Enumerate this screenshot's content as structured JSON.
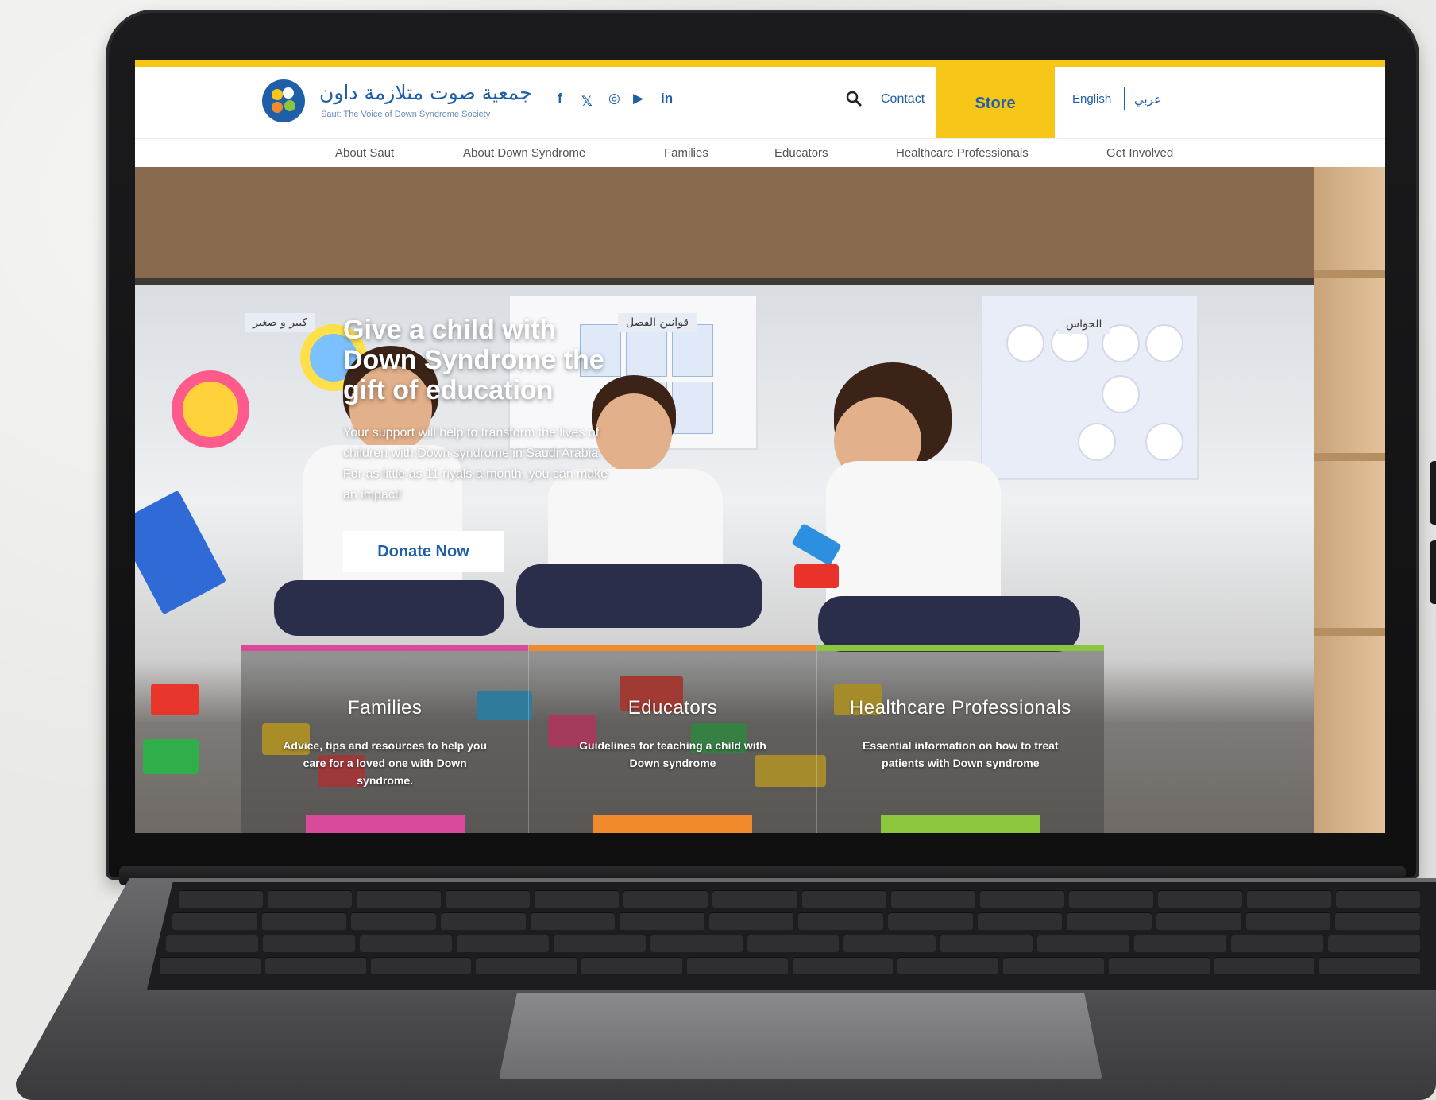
{
  "header": {
    "logo_title": "جمعية صوت متلازمة داون",
    "logo_subtitle": "Saut: The Voice of Down Syndrome Society",
    "social": [
      "f",
      "𝕏",
      "◎",
      "▶",
      "in"
    ],
    "search_placeholder": "",
    "contact_label": "Contact",
    "store_label": "Store",
    "lang_en": "English",
    "lang_ar": "عربي",
    "accent": "#f6c619",
    "brand": "#1f5fa8"
  },
  "nav": {
    "items": [
      "About Saut",
      "About Down Syndrome",
      "Families",
      "Educators",
      "Healthcare Professionals",
      "Get Involved"
    ]
  },
  "hero": {
    "title": "Give a child with Down Syndrome the gift of education",
    "text": "Your support will help to transform the lives of children with Down syndrome in Saudi Arabia. For as little as 11 riyals a month, you can make an impact!",
    "donate_label": "Donate Now",
    "tags": [
      "كبير و صغير",
      "قوانين الفصل",
      "الحواس"
    ]
  },
  "cards": [
    {
      "title": "Families",
      "text": "Advice, tips and resources to help you care for a loved one with Down syndrome.",
      "color": "#d94a9b"
    },
    {
      "title": "Educators",
      "text": "Guidelines for teaching a child with Down syndrome",
      "color": "#f08a2c"
    },
    {
      "title": "Healthcare Professionals",
      "text": "Essential information on how to treat patients with Down syndrome",
      "color": "#8cc63f"
    }
  ]
}
